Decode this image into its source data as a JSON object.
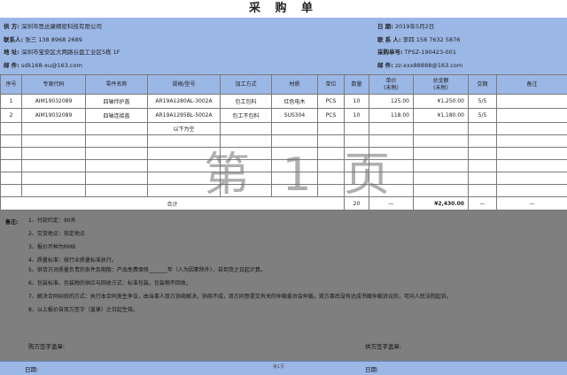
{
  "title": "采 购 单",
  "supplier": {
    "vendor_label": "供  方:",
    "vendor": "深圳市思达康精密科技有限公司",
    "contact_label": "联系人:",
    "contact": "张三   138 8968 2689",
    "address_label": "地   址:",
    "address": "深圳市宝安区大两路谷盘工业区5栋 1F",
    "email_label": "邮   件:",
    "email": "sdk168-xu@163.com"
  },
  "buyer": {
    "date_label": "日      期:",
    "date": "2019年5月2日",
    "contact_label": "联 系 人:",
    "contact": "李四  158 7632 5876",
    "po_label": "采购单号:",
    "po": "TPSZ-190423-001",
    "email_label": "邮      件:",
    "email": "zz-xxx88888@163.com"
  },
  "table": {
    "headers": [
      "序号",
      "专案代码",
      "零件名称",
      "规格/型号",
      "加工方式",
      "材质",
      "单位",
      "数量",
      "单价\n(未税)",
      "总金额\n(未税)",
      "交期",
      "备注"
    ],
    "rows": [
      [
        "1",
        "AIM19032089",
        "四轴伴护盖",
        "AR19A1280AL-3002A",
        "包工包料",
        "红色电木",
        "PCS",
        "10",
        "125.00",
        "¥1,250.00",
        "5/5",
        ""
      ],
      [
        "2",
        "AIM19032089",
        "四轴连接盖",
        "AR19A1295BL-5002A",
        "包工不包料",
        "SUS304",
        "PCS",
        "10",
        "118.00",
        "¥1,180.00",
        "5/5",
        ""
      ]
    ],
    "empty_note": "以下为空",
    "total_label": "合计",
    "total_qty": "20",
    "total_unit_price": "—",
    "total_amount": "¥2,430.00",
    "total_delivery": "—",
    "total_remark": "—"
  },
  "watermark": "第 1 页",
  "terms": {
    "lead": "备注:",
    "items": [
      "1、付款约定：90天",
      "2、交货地点：指定地点",
      "3、报价币种为RMB",
      "4、质量标准：按行业质量标准执行。",
      "5、供货方对质量负责的条件及期限：产品免费保修_______年（人为因素除外），自到货之日起计算。",
      "6、包装标准、包装物的供应与回收方式：标准包装，包装物不回收。",
      "7、解决合同纠纷的方式：执行本合同发生争议，由当事人双方协商解决，协商不成，双方同意提交有关的仲裁委员会仲裁，双方事后没有达成书面仲裁协议的，可向人民法院起诉。",
      "8、以上报价自双方签字（盖章）之日起生效。"
    ]
  },
  "signatures": {
    "buyer_sign": "购方签字盖章:",
    "supplier_sign": "供方签字盖章:",
    "buyer_date": "日期:",
    "supplier_date": "日期:"
  },
  "page_number": "第1页"
}
